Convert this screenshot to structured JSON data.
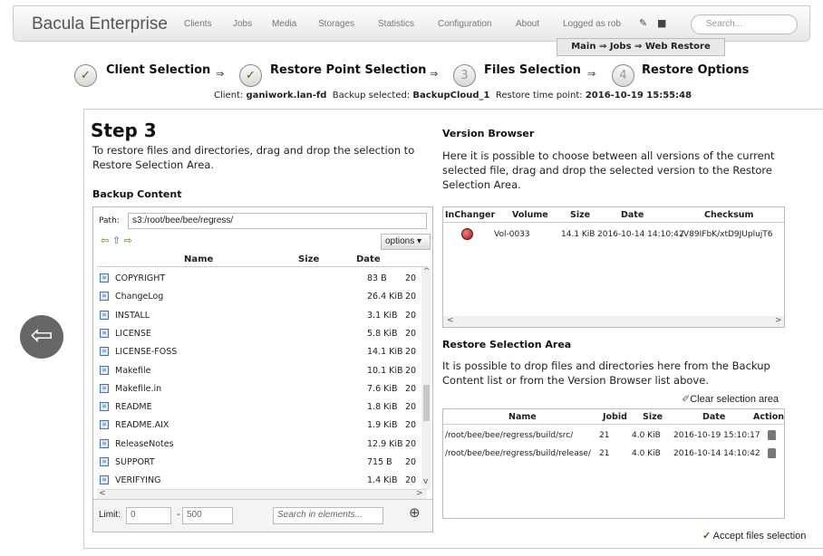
{
  "header": {
    "brand": "Bacula Enterprise",
    "nav": [
      "Clients",
      "Jobs",
      "Media",
      "Storages",
      "Statistics",
      "Configuration",
      "About"
    ],
    "logged_in": "Logged as rob",
    "search_placeholder": "Search...",
    "breadcrumb": "Main ⇒ Jobs ⇒ Web Restore"
  },
  "wizard": {
    "steps": [
      {
        "num": "✓",
        "label": "Client Selection"
      },
      {
        "num": "✓",
        "label": "Restore Point Selection"
      },
      {
        "num": "3",
        "label": "Files Selection"
      },
      {
        "num": "4",
        "label": "Restore Options"
      }
    ],
    "arrow": "⇒",
    "client_label": "Client:",
    "client": "ganiwork.lan-fd",
    "backup_label": "Backup selected:",
    "backup": "BackupCloud_1",
    "time_label": "Restore time point:",
    "time": "2016-10-19 15:55:48"
  },
  "left": {
    "title": "Step 3",
    "intro": "To restore files and directories, drag and drop the selection to Restore Selection Area.",
    "backup_content": "Backup Content",
    "path_label": "Path:",
    "path_value": "s3:/root/bee/bee/regress/",
    "options": "options",
    "columns": {
      "name": "Name",
      "size": "Size",
      "date": "Date"
    },
    "files": [
      {
        "name": "COPYRIGHT",
        "size": "83 B",
        "date": "20"
      },
      {
        "name": "ChangeLog",
        "size": "26.4 KiB",
        "date": "20"
      },
      {
        "name": "INSTALL",
        "size": "3.1 KiB",
        "date": "20"
      },
      {
        "name": "LICENSE",
        "size": "5.8 KiB",
        "date": "20"
      },
      {
        "name": "LICENSE-FOSS",
        "size": "14.1 KiB",
        "date": "20"
      },
      {
        "name": "Makefile",
        "size": "10.1 KiB",
        "date": "20"
      },
      {
        "name": "Makefile.in",
        "size": "7.6 KiB",
        "date": "20"
      },
      {
        "name": "README",
        "size": "1.8 KiB",
        "date": "20"
      },
      {
        "name": "README.AIX",
        "size": "1.9 KiB",
        "date": "20"
      },
      {
        "name": "ReleaseNotes",
        "size": "12.9 KiB",
        "date": "20"
      },
      {
        "name": "SUPPORT",
        "size": "715 B",
        "date": "20"
      },
      {
        "name": "VERIFYING",
        "size": "1.4 KiB",
        "date": "20"
      }
    ],
    "limit_label": "Limit:",
    "limit_from": "0",
    "limit_sep": "-",
    "limit_to": "500",
    "search_placeholder": "Search in elements..."
  },
  "right": {
    "version_title": "Version Browser",
    "version_intro": "Here it is possible to choose between all versions of the current selected file, drag and drop the selected version to the Restore Selection Area.",
    "version_cols": {
      "inchanger": "InChanger",
      "volume": "Volume",
      "size": "Size",
      "date": "Date",
      "checksum": "Checksum"
    },
    "version_row": {
      "volume": "Vol-0033",
      "size": "14.1 KiB",
      "date": "2016-10-14 14:10:42",
      "checksum": "/V89IFbK/xtD9JUplujT6"
    },
    "restore_title": "Restore Selection Area",
    "restore_intro": "It is possible to drop files and directories here from the Backup Content list or from the Version Browser list above.",
    "clear": "Clear selection area",
    "restore_cols": {
      "name": "Name",
      "jobid": "Jobid",
      "size": "Size",
      "date": "Date",
      "action": "Action"
    },
    "restore_rows": [
      {
        "name": "/root/bee/bee/regress/build/src/",
        "jobid": "21",
        "size": "4.0 KiB",
        "date": "2016-10-19 15:10:17"
      },
      {
        "name": "/root/bee/bee/regress/build/release/",
        "jobid": "21",
        "size": "4.0 KiB",
        "date": "2016-10-14 14:10:42"
      }
    ],
    "accept": "Accept files selection"
  }
}
